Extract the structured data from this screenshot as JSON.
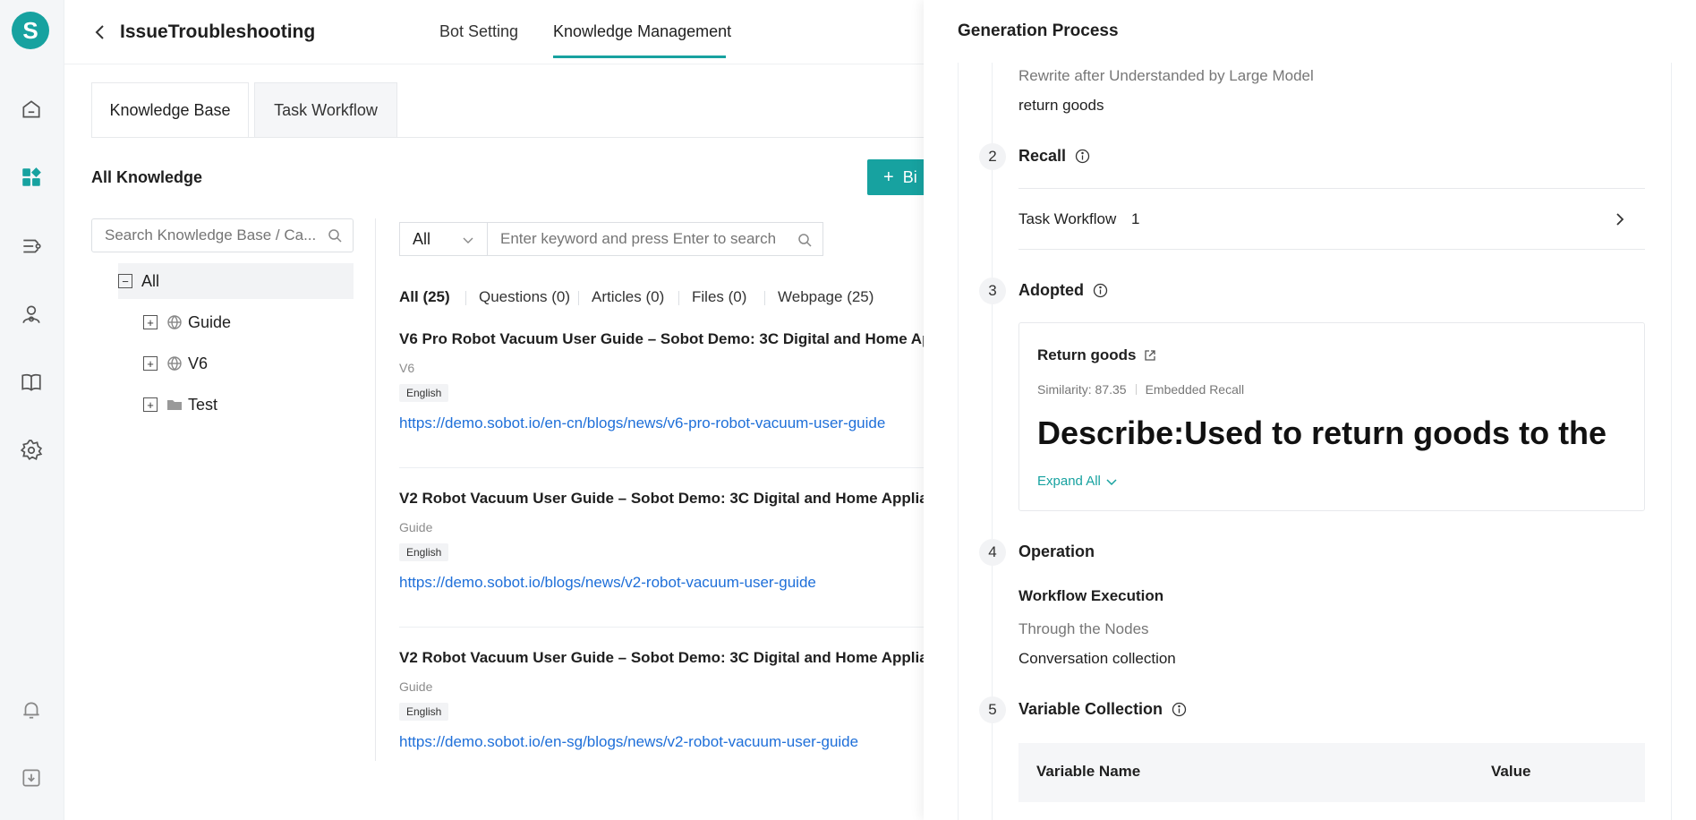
{
  "rail": {
    "logo_letter": "S",
    "icons": [
      "home-icon",
      "dashboard-icon",
      "routing-icon",
      "agent-icon",
      "book-icon",
      "settings-icon",
      "bell-icon",
      "download-icon"
    ]
  },
  "header": {
    "title": "IssueTroubleshooting",
    "tabs": [
      "Bot Setting",
      "Knowledge Management"
    ],
    "active_tab": "Knowledge Management"
  },
  "sub_tabs": [
    "Knowledge Base",
    "Task Workflow"
  ],
  "knowledge": {
    "section_title": "All Knowledge",
    "batch_button_label": "Bi",
    "tree_search_placeholder": "Search Knowledge Base / Ca...",
    "tree": [
      {
        "label": "All",
        "toggle": "−"
      },
      {
        "label": "Guide",
        "toggle": "+",
        "icon": "globe-icon"
      },
      {
        "label": "V6",
        "toggle": "+",
        "icon": "globe-icon"
      },
      {
        "label": "Test",
        "toggle": "+",
        "icon": "folder-icon"
      }
    ],
    "filter_select_value": "All",
    "filter_placeholder": "Enter keyword and press Enter to search",
    "type_tabs": [
      "All (25)",
      "Questions (0)",
      "Articles (0)",
      "Files (0)",
      "Webpage (25)"
    ],
    "items": [
      {
        "title": "V6 Pro Robot Vacuum User Guide – Sobot Demo: 3C Digital and Home Ap",
        "category": "V6",
        "language": "English",
        "url": "https://demo.sobot.io/en-cn/blogs/news/v6-pro-robot-vacuum-user-guide"
      },
      {
        "title": "V2 Robot Vacuum User Guide – Sobot Demo: 3C Digital and Home Applia",
        "category": "Guide",
        "language": "English",
        "url": "https://demo.sobot.io/blogs/news/v2-robot-vacuum-user-guide"
      },
      {
        "title": "V2 Robot Vacuum User Guide – Sobot Demo: 3C Digital and Home Applia",
        "category": "Guide",
        "language": "English",
        "url": "https://demo.sobot.io/en-sg/blogs/news/v2-robot-vacuum-user-guide"
      }
    ]
  },
  "panel": {
    "title": "Generation Process",
    "rewrite_label": "Rewrite after Understanded by Large Model",
    "rewrite_value": "return goods",
    "steps": [
      {
        "num": "2",
        "title": "Recall"
      },
      {
        "num": "3",
        "title": "Adopted"
      },
      {
        "num": "4",
        "title": "Operation"
      },
      {
        "num": "5",
        "title": "Variable Collection"
      }
    ],
    "recall": {
      "label": "Task Workflow",
      "count": "1"
    },
    "adopted": {
      "title": "Return goods",
      "similarity": "Similarity: 87.35",
      "recall_type": "Embedded Recall",
      "describe": "Describe:Used to return goods to the",
      "expand_label": "Expand All"
    },
    "operation": {
      "heading": "Workflow Execution",
      "nodes_label": "Through the Nodes",
      "node_value": "Conversation collection"
    },
    "variable_table": {
      "headers": [
        "Variable Name",
        "Value"
      ]
    }
  },
  "colors": {
    "accent": "#17a2a0",
    "link": "#1e6fd9"
  }
}
